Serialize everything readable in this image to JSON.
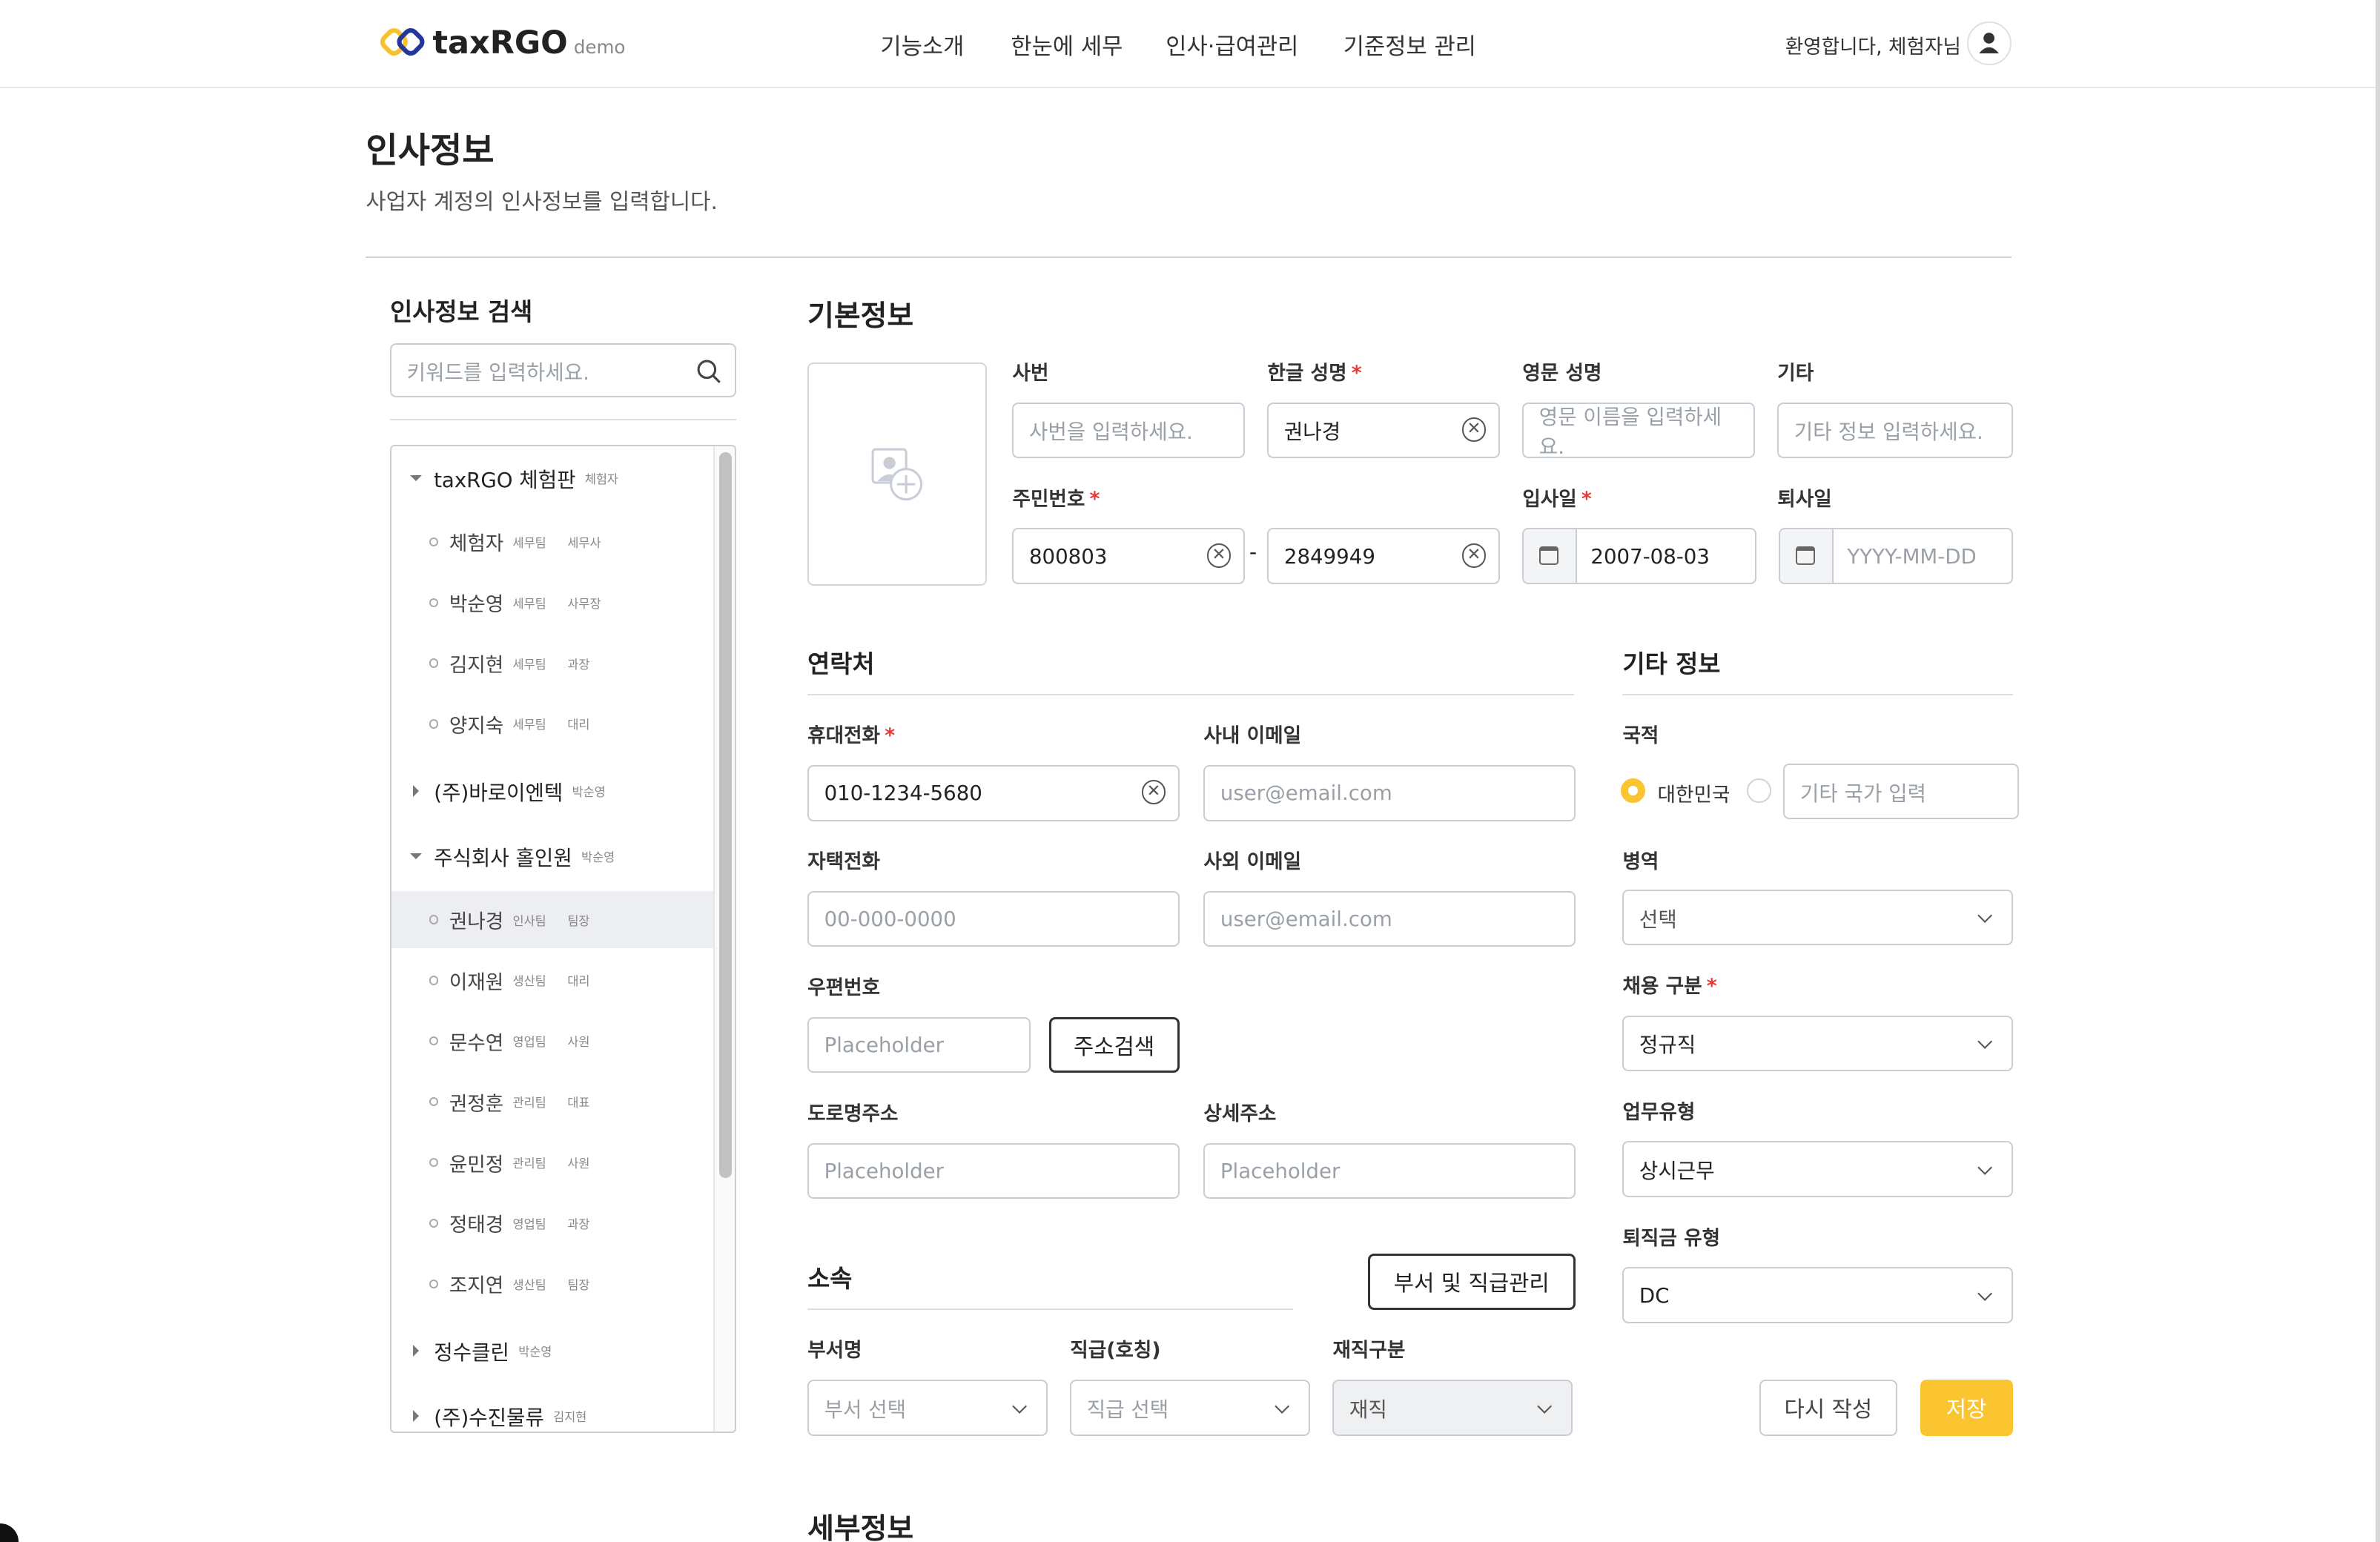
{
  "header": {
    "logo_text": "taxRGO",
    "logo_suffix": "demo",
    "nav": [
      "기능소개",
      "한눈에 세무",
      "인사·급여관리",
      "기준정보 관리"
    ],
    "welcome": "환영합니다, 체험자님"
  },
  "page": {
    "title": "인사정보",
    "subtitle": "사업자 계정의 인사정보를 입력합니다."
  },
  "sidebar": {
    "title": "인사정보 검색",
    "search_placeholder": "키워드를 입력하세요.",
    "tree": [
      {
        "type": "group",
        "open": true,
        "label": "taxRGO 체험판",
        "sub": "체험자"
      },
      {
        "type": "item",
        "label": "체험자",
        "dept": "세무팀",
        "rank": "세무사"
      },
      {
        "type": "item",
        "label": "박순영",
        "dept": "세무팀",
        "rank": "사무장"
      },
      {
        "type": "item",
        "label": "김지현",
        "dept": "세무팀",
        "rank": "과장"
      },
      {
        "type": "item",
        "label": "양지숙",
        "dept": "세무팀",
        "rank": "대리"
      },
      {
        "type": "group",
        "open": false,
        "label": "(주)바로이엔텍",
        "sub": "박순영"
      },
      {
        "type": "group",
        "open": true,
        "label": "주식회사 홀인원",
        "sub": "박순영"
      },
      {
        "type": "item",
        "label": "권나경",
        "dept": "인사팀",
        "rank": "팀장",
        "selected": true
      },
      {
        "type": "item",
        "label": "이재원",
        "dept": "생산팀",
        "rank": "대리"
      },
      {
        "type": "item",
        "label": "문수연",
        "dept": "영업팀",
        "rank": "사원"
      },
      {
        "type": "item",
        "label": "권정훈",
        "dept": "관리팀",
        "rank": "대표"
      },
      {
        "type": "item",
        "label": "윤민정",
        "dept": "관리팀",
        "rank": "사원"
      },
      {
        "type": "item",
        "label": "정태경",
        "dept": "영업팀",
        "rank": "과장"
      },
      {
        "type": "item",
        "label": "조지연",
        "dept": "생산팀",
        "rank": "팀장"
      },
      {
        "type": "group",
        "open": false,
        "label": "정수클린",
        "sub": "박순영"
      },
      {
        "type": "group",
        "open": false,
        "label": "(주)수진물류",
        "sub": "김지현"
      }
    ]
  },
  "basic": {
    "title": "기본정보",
    "emp_no": {
      "label": "사번",
      "placeholder": "사번을 입력하세요."
    },
    "kor_name": {
      "label": "한글 성명",
      "value": "권나경"
    },
    "eng_name": {
      "label": "영문 성명",
      "placeholder": "영문 이름을 입력하세요."
    },
    "etc": {
      "label": "기타",
      "placeholder": "기타 정보 입력하세요."
    },
    "rrn": {
      "label": "주민번호",
      "front": "800803",
      "back": "2849949",
      "sep": "-"
    },
    "join_date": {
      "label": "입사일",
      "value": "2007-08-03"
    },
    "leave_date": {
      "label": "퇴사일",
      "placeholder": "YYYY-MM-DD"
    }
  },
  "contact": {
    "title": "연락처",
    "mobile": {
      "label": "휴대전화",
      "value": "010-1234-5680"
    },
    "work_email": {
      "label": "사내 이메일",
      "placeholder": "user@email.com"
    },
    "home_phone": {
      "label": "자택전화",
      "placeholder": "00-000-0000"
    },
    "personal_email": {
      "label": "사외 이메일",
      "placeholder": "user@email.com"
    },
    "zip": {
      "label": "우편번호",
      "placeholder": "Placeholder",
      "button": "주소검색"
    },
    "road": {
      "label": "도로명주소",
      "placeholder": "Placeholder"
    },
    "detail": {
      "label": "상세주소",
      "placeholder": "Placeholder"
    }
  },
  "affiliation": {
    "title": "소속",
    "manage_button": "부서 및 직급관리",
    "dept": {
      "label": "부서명",
      "placeholder": "부서 선택"
    },
    "rank": {
      "label": "직급(호칭)",
      "placeholder": "직급 선택"
    },
    "status": {
      "label": "재직구분",
      "value": "재직"
    }
  },
  "other": {
    "title": "기타 정보",
    "nationality": {
      "label": "국적",
      "option_korea": "대한민국",
      "selected": "대한민국",
      "other_placeholder": "기타 국가 입력"
    },
    "military": {
      "label": "병역",
      "value": "선택"
    },
    "employment": {
      "label": "채용 구분",
      "value": "정규직"
    },
    "work_type": {
      "label": "업무유형",
      "value": "상시근무"
    },
    "severance": {
      "label": "퇴직금 유형",
      "value": "DC"
    }
  },
  "actions": {
    "reset": "다시 작성",
    "save": "저장"
  },
  "detail_section": {
    "title": "세부정보"
  },
  "required_mark": "*",
  "colors": {
    "accent": "#FBC431",
    "required": "#E53935",
    "logo_yellow": "#F6C230",
    "logo_blue": "#23389A"
  }
}
